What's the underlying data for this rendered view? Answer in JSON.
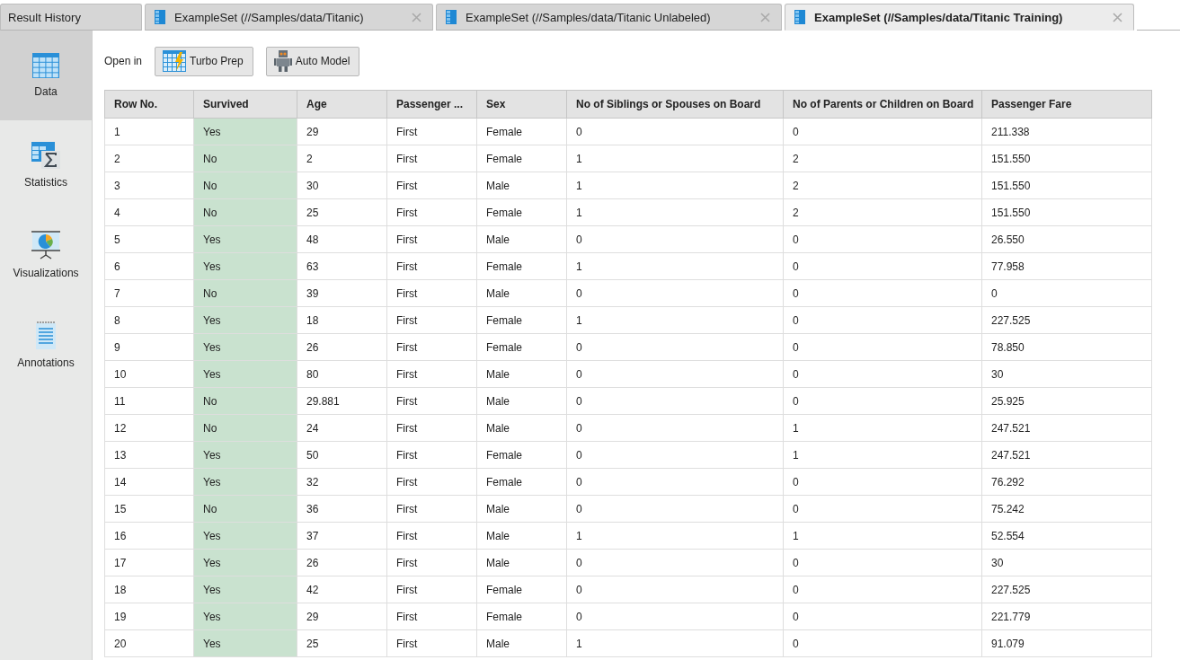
{
  "tabs": [
    {
      "label": "Result History",
      "kind": "plain",
      "selected": false,
      "closable": false
    },
    {
      "label": "ExampleSet (//Samples/data/Titanic)",
      "kind": "exampleset",
      "selected": false,
      "closable": true
    },
    {
      "label": "ExampleSet (//Samples/data/Titanic Unlabeled)",
      "kind": "exampleset",
      "selected": false,
      "closable": true
    },
    {
      "label": "ExampleSet (//Samples/data/Titanic Training)",
      "kind": "exampleset",
      "selected": true,
      "closable": true
    }
  ],
  "sidebar": {
    "items": [
      {
        "label": "Data",
        "kind": "data",
        "selected": true
      },
      {
        "label": "Statistics",
        "kind": "statistics",
        "selected": false
      },
      {
        "label": "Visualizations",
        "kind": "visualizations",
        "selected": false
      },
      {
        "label": "Annotations",
        "kind": "annotations",
        "selected": false
      }
    ]
  },
  "toolbar": {
    "label": "Open in",
    "buttons": [
      {
        "label": "Turbo Prep",
        "kind": "turboprep"
      },
      {
        "label": "Auto Model",
        "kind": "automodel"
      }
    ]
  },
  "table": {
    "columns": [
      {
        "label": "Row No.",
        "highlighted": false
      },
      {
        "label": "Survived",
        "highlighted": true
      },
      {
        "label": "Age",
        "highlighted": false
      },
      {
        "label": "Passenger ...",
        "highlighted": false
      },
      {
        "label": "Sex",
        "highlighted": false
      },
      {
        "label": "No of Siblings or Spouses on Board",
        "highlighted": false
      },
      {
        "label": "No of Parents or Children on Board",
        "highlighted": false
      },
      {
        "label": "Passenger Fare",
        "highlighted": false
      }
    ],
    "rows": [
      [
        "1",
        "Yes",
        "29",
        "First",
        "Female",
        "0",
        "0",
        "211.338"
      ],
      [
        "2",
        "No",
        "2",
        "First",
        "Female",
        "1",
        "2",
        "151.550"
      ],
      [
        "3",
        "No",
        "30",
        "First",
        "Male",
        "1",
        "2",
        "151.550"
      ],
      [
        "4",
        "No",
        "25",
        "First",
        "Female",
        "1",
        "2",
        "151.550"
      ],
      [
        "5",
        "Yes",
        "48",
        "First",
        "Male",
        "0",
        "0",
        "26.550"
      ],
      [
        "6",
        "Yes",
        "63",
        "First",
        "Female",
        "1",
        "0",
        "77.958"
      ],
      [
        "7",
        "No",
        "39",
        "First",
        "Male",
        "0",
        "0",
        "0"
      ],
      [
        "8",
        "Yes",
        "18",
        "First",
        "Female",
        "1",
        "0",
        "227.525"
      ],
      [
        "9",
        "Yes",
        "26",
        "First",
        "Female",
        "0",
        "0",
        "78.850"
      ],
      [
        "10",
        "Yes",
        "80",
        "First",
        "Male",
        "0",
        "0",
        "30"
      ],
      [
        "11",
        "No",
        "29.881",
        "First",
        "Male",
        "0",
        "0",
        "25.925"
      ],
      [
        "12",
        "No",
        "24",
        "First",
        "Male",
        "0",
        "1",
        "247.521"
      ],
      [
        "13",
        "Yes",
        "50",
        "First",
        "Female",
        "0",
        "1",
        "247.521"
      ],
      [
        "14",
        "Yes",
        "32",
        "First",
        "Female",
        "0",
        "0",
        "76.292"
      ],
      [
        "15",
        "No",
        "36",
        "First",
        "Male",
        "0",
        "0",
        "75.242"
      ],
      [
        "16",
        "Yes",
        "37",
        "First",
        "Male",
        "1",
        "1",
        "52.554"
      ],
      [
        "17",
        "Yes",
        "26",
        "First",
        "Male",
        "0",
        "0",
        "30"
      ],
      [
        "18",
        "Yes",
        "42",
        "First",
        "Female",
        "0",
        "0",
        "227.525"
      ],
      [
        "19",
        "Yes",
        "29",
        "First",
        "Female",
        "0",
        "0",
        "221.779"
      ],
      [
        "20",
        "Yes",
        "25",
        "First",
        "Male",
        "1",
        "0",
        "91.079"
      ]
    ]
  }
}
